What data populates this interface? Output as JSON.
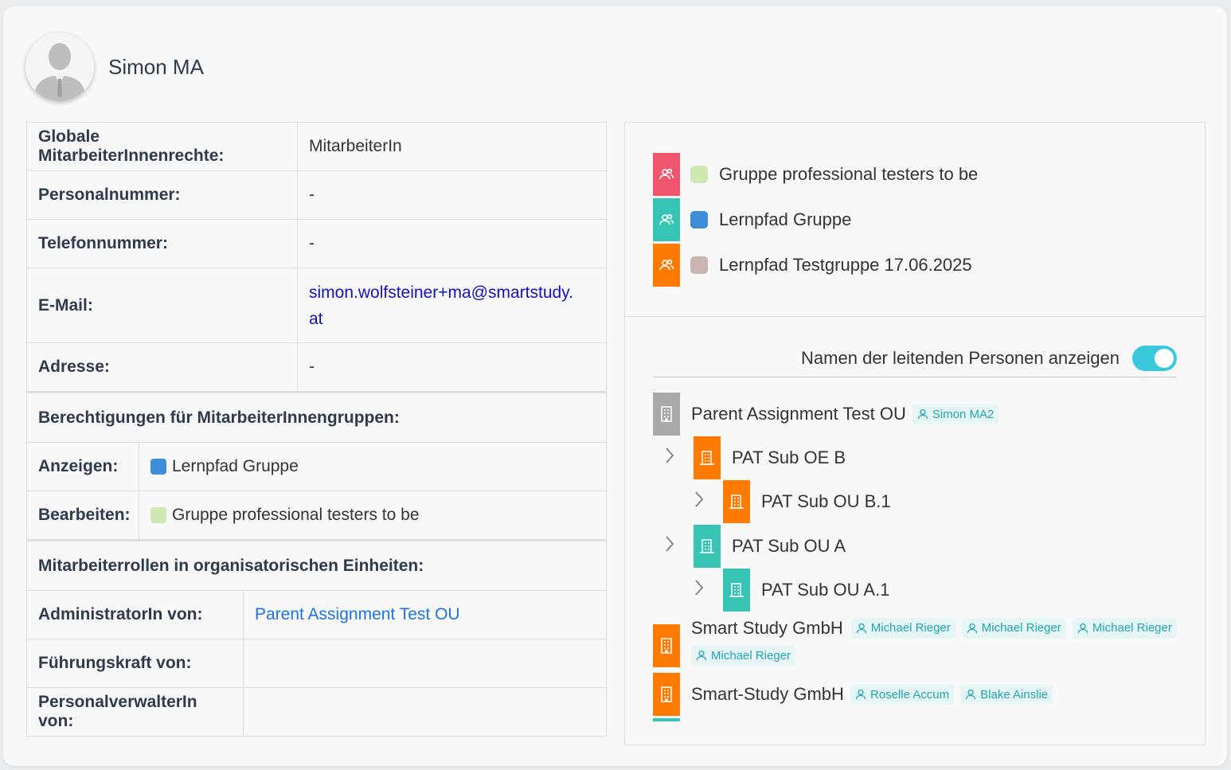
{
  "profile": {
    "name": "Simon MA"
  },
  "info": [
    {
      "label": "Globale MitarbeiterInnenrechte:",
      "value": "MitarbeiterIn"
    },
    {
      "label": "Personalnummer:",
      "value": "-"
    },
    {
      "label": "Telefonnummer:",
      "value": "-"
    },
    {
      "label": "E-Mail:",
      "value_line1": "simon.wolfsteiner+ma@smartstudy.",
      "value_line2": "at"
    },
    {
      "label": "Adresse:",
      "value": "-"
    }
  ],
  "group_permissions": {
    "heading": "Berechtigungen für MitarbeiterInnengruppen:",
    "rows": [
      {
        "label": "Anzeigen:",
        "value": "Lernpfad Gruppe",
        "color": "#3b8fd8"
      },
      {
        "label": "Bearbeiten:",
        "value": "Gruppe professional testers to be",
        "color": "#cde8b0"
      }
    ]
  },
  "org_roles": {
    "heading": "Mitarbeiterrollen in organisatorischen Einheiten:",
    "rows": [
      {
        "label": "AdministratorIn von:",
        "value": "Parent Assignment Test OU"
      },
      {
        "label": "Führungskraft von:",
        "value": ""
      },
      {
        "label": "PersonalverwalterIn von:",
        "value": ""
      }
    ]
  },
  "groups": [
    {
      "name": "Gruppe professional testers to be",
      "icon": "users-icon",
      "icon_color": "#f0566e",
      "dot_color": "#cde8b0"
    },
    {
      "name": "Lernpfad Gruppe",
      "icon": "users-icon",
      "icon_color": "#38c4b4",
      "dot_color": "#3b8fd8"
    },
    {
      "name": "Lernpfad Testgruppe 17.06.2025",
      "icon": "users-icon",
      "icon_color": "#ff7a00",
      "dot_color": "#c8b4b0"
    }
  ],
  "toggle": {
    "label": "Namen der leitenden Personen anzeigen",
    "on": true,
    "color": "#3cc8dc"
  },
  "org_units": [
    {
      "name": "Parent Assignment Test OU",
      "icon": "building-icon",
      "color": "#a8a8a8",
      "leaders": [
        "Simon MA2"
      ]
    },
    {
      "name": "PAT Sub OE B",
      "icon": "building-icon",
      "color": "#ff7a00",
      "leaders": []
    },
    {
      "name": "PAT Sub OU B.1",
      "icon": "building-icon",
      "color": "#ff7a00",
      "leaders": []
    },
    {
      "name": "PAT Sub OU A",
      "icon": "building-icon",
      "color": "#38c4b4",
      "leaders": []
    },
    {
      "name": "PAT Sub OU A.1",
      "icon": "building-icon",
      "color": "#38c4b4",
      "leaders": []
    },
    {
      "name": "Smart Study GmbH",
      "icon": "building-icon",
      "color": "#ff7a00",
      "leaders": [
        "Michael Rieger",
        "Michael Rieger",
        "Michael Rieger",
        "Michael Rieger"
      ]
    },
    {
      "name": "Smart-Study GmbH",
      "icon": "building-icon",
      "color": "#ff7a00",
      "leaders": [
        "Roselle Accum",
        "Blake Ainslie"
      ]
    }
  ]
}
